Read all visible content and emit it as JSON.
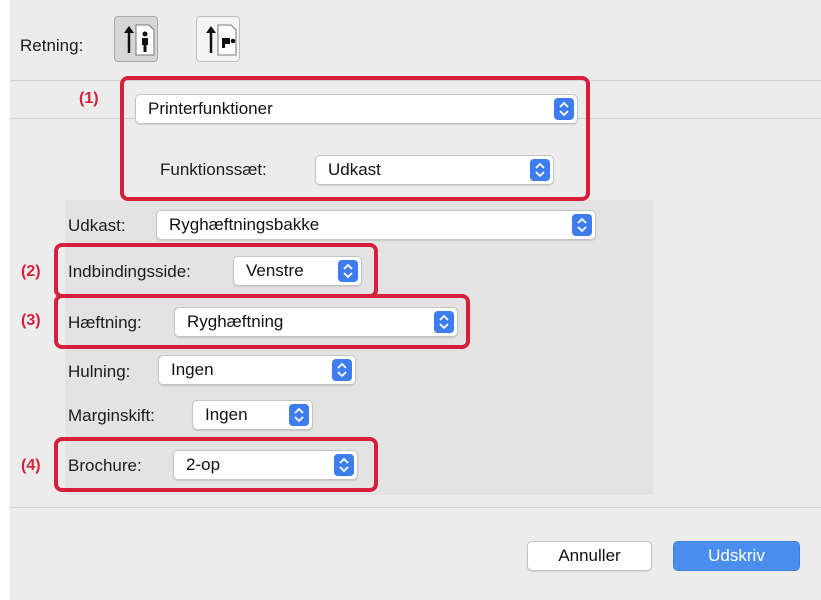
{
  "orientation": {
    "label": "Retning:",
    "options": [
      "portrait-icon",
      "landscape-icon"
    ],
    "selected": "portrait-icon"
  },
  "callouts": [
    "(1)",
    "(2)",
    "(3)",
    "(4)"
  ],
  "printer_functions": {
    "section_value": "Printerfunktioner",
    "feature_set_label": "Funktionssæt:",
    "feature_set_value": "Udkast"
  },
  "options": {
    "output_label": "Udkast:",
    "output_value": "Ryghæftningsbakke",
    "binding_label": "Indbindingsside:",
    "binding_value": "Venstre",
    "staple_label": "Hæftning:",
    "staple_value": "Ryghæftning",
    "punch_label": "Hulning:",
    "punch_value": "Ingen",
    "margin_label": "Marginskift:",
    "margin_value": "Ingen",
    "booklet_label": "Brochure:",
    "booklet_value": "2-op"
  },
  "buttons": {
    "cancel": "Annuller",
    "print": "Udskriv"
  },
  "colors": {
    "accent": "#3d7ded",
    "callout": "#d71f3b",
    "primary_button": "#4a8ff0"
  }
}
